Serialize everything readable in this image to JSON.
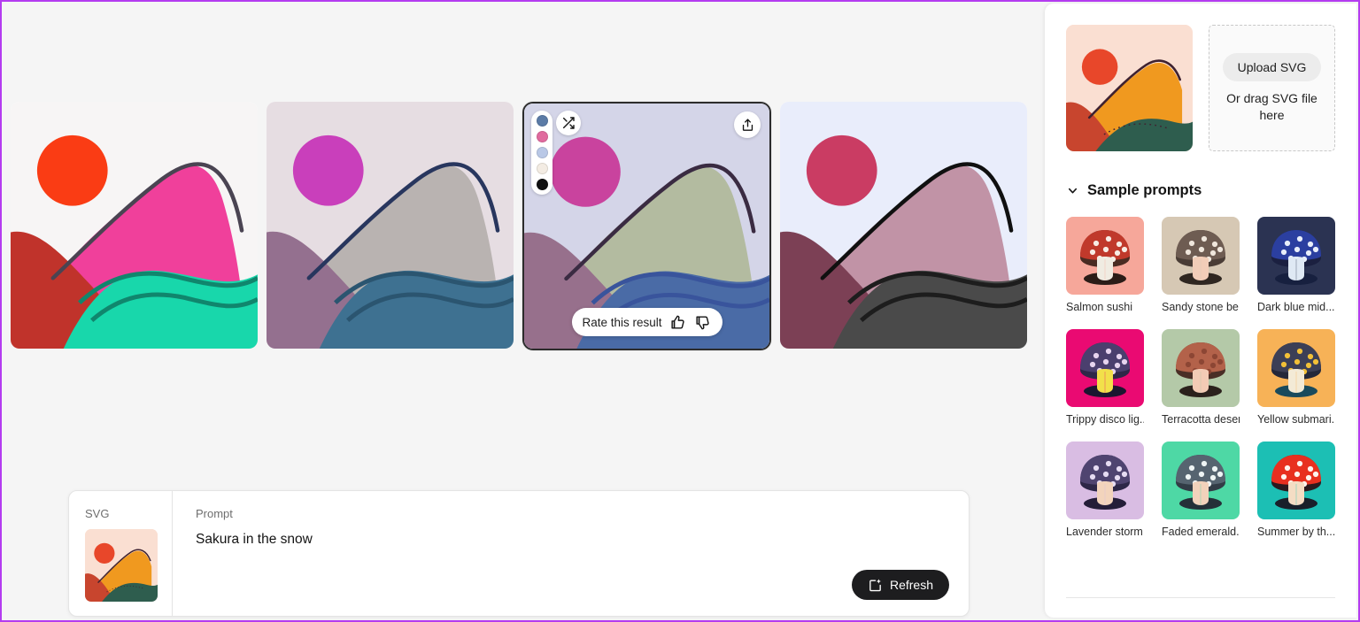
{
  "accent_color": "#b43cf0",
  "workspace": {
    "results": [
      {
        "name": "result-1",
        "selected": false,
        "sky": "#f7f5f5",
        "sun": "#fa3c14",
        "mountain_back": "#f0409b",
        "mountain_front": "#c0332b",
        "water": "#18d7ab",
        "wave_line": "#10866d",
        "ridge_line": "#4a4452"
      },
      {
        "name": "result-2",
        "selected": false,
        "sky": "#e6dde2",
        "sun": "#c93fbb",
        "mountain_back": "#b9b3b1",
        "mountain_front": "#94708f",
        "water": "#3e7191",
        "wave_line": "#2b5570",
        "ridge_line": "#28365e"
      },
      {
        "name": "result-3",
        "selected": true,
        "sky": "#d4d5e8",
        "sun": "#c9439e",
        "mountain_back": "#b3bba0",
        "mountain_front": "#97708c",
        "water": "#4a6ba6",
        "wave_line": "#39549c",
        "ridge_line": "#3a2b42"
      },
      {
        "name": "result-4",
        "selected": false,
        "sky": "#e9edfb",
        "sun": "#ca3c63",
        "mountain_back": "#c193a6",
        "mountain_front": "#7c4055",
        "water": "#4a4a4a",
        "wave_line": "#1d1d1d",
        "ridge_line": "#101010"
      }
    ],
    "selected_overlay": {
      "swatches": [
        {
          "name": "swatch-slate-blue",
          "color": "#5b7ba6"
        },
        {
          "name": "swatch-pink",
          "color": "#e06a9e"
        },
        {
          "name": "swatch-light-blue",
          "color": "#b9c8e6"
        },
        {
          "name": "swatch-cream",
          "color": "#f3ece3"
        },
        {
          "name": "swatch-black",
          "color": "#111111"
        }
      ],
      "shuffle_icon": "shuffle-icon",
      "share_icon": "share-icon",
      "rate_label": "Rate this result",
      "thumbs_up_icon": "thumbs-up-icon",
      "thumbs_down_icon": "thumbs-down-icon"
    }
  },
  "prompt_bar": {
    "svg_label": "SVG",
    "prompt_label": "Prompt",
    "prompt_value": "Sakura in the snow",
    "refresh_label": "Refresh",
    "refresh_icon": "refresh-sparkle-icon",
    "thumbnail": {
      "sky": "#fadfd2",
      "sun": "#e8472a",
      "hill_orange": "#f0991f",
      "hill_red": "#c8452e",
      "hill_green": "#2e5d4e",
      "line": "#3f2230"
    }
  },
  "right_panel": {
    "preview": {
      "sky": "#fadfd2",
      "sun": "#e8472a",
      "hill_orange": "#f0991f",
      "hill_red": "#c8452e",
      "hill_green": "#2e5d4e",
      "line": "#3f2230"
    },
    "upload_button_label": "Upload SVG",
    "drop_hint": "Or drag SVG file here",
    "samples_title": "Sample prompts",
    "samples_chevron_icon": "chevron-down-icon",
    "samples": [
      {
        "label": "Salmon sushi",
        "bg": "#f6a79a",
        "cap": "#c0392b",
        "cap_dark": "#4a2b22",
        "stem": "#f0ece2",
        "dots": "#f7ece4",
        "shadow": "#2b1c17"
      },
      {
        "label": "Sandy stone be...",
        "bg": "#d6c8b4",
        "cap": "#6e5c52",
        "cap_dark": "#4a3d36",
        "stem": "#f2cdb8",
        "dots": "#efe6dc",
        "shadow": "#2f2721"
      },
      {
        "label": "Dark blue mid...",
        "bg": "#2b3352",
        "cap": "#2b3fa0",
        "cap_dark": "#1b2040",
        "stem": "#dfe9f4",
        "dots": "#e8eefa",
        "shadow": "#17203f"
      },
      {
        "label": "Trippy disco lig...",
        "bg": "#ea0a72",
        "cap": "#4b3f6e",
        "cap_dark": "#2f2748",
        "stem": "#f2e04a",
        "dots": "#e7d4ef",
        "shadow": "#1c1630"
      },
      {
        "label": "Terracotta desert",
        "bg": "#b4c9a8",
        "cap": "#b3624a",
        "cap_dark": "#4a2e26",
        "stem": "#f3cbb5",
        "dots": "#8c4634",
        "shadow": "#2b211c"
      },
      {
        "label": "Yellow submari...",
        "bg": "#f7b257",
        "cap": "#3c3f56",
        "cap_dark": "#24283a",
        "stem": "#f3ead6",
        "dots": "#f2c037",
        "shadow": "#1a4a5c"
      },
      {
        "label": "Lavender storm",
        "bg": "#d9bde3",
        "cap": "#4f4470",
        "cap_dark": "#2d2747",
        "stem": "#f3d4bc",
        "dots": "#e6dcf2",
        "shadow": "#241d38"
      },
      {
        "label": "Faded emerald...",
        "bg": "#4ed8a5",
        "cap": "#566470",
        "cap_dark": "#323c46",
        "stem": "#f2d2bb",
        "dots": "#eef4f4",
        "shadow": "#253038"
      },
      {
        "label": "Summer by th...",
        "bg": "#1cbfb4",
        "cap": "#e8301f",
        "cap_dark": "#2b1a1e",
        "stem": "#f4ddc4",
        "dots": "#fdf4ef",
        "shadow": "#19202a"
      }
    ]
  }
}
